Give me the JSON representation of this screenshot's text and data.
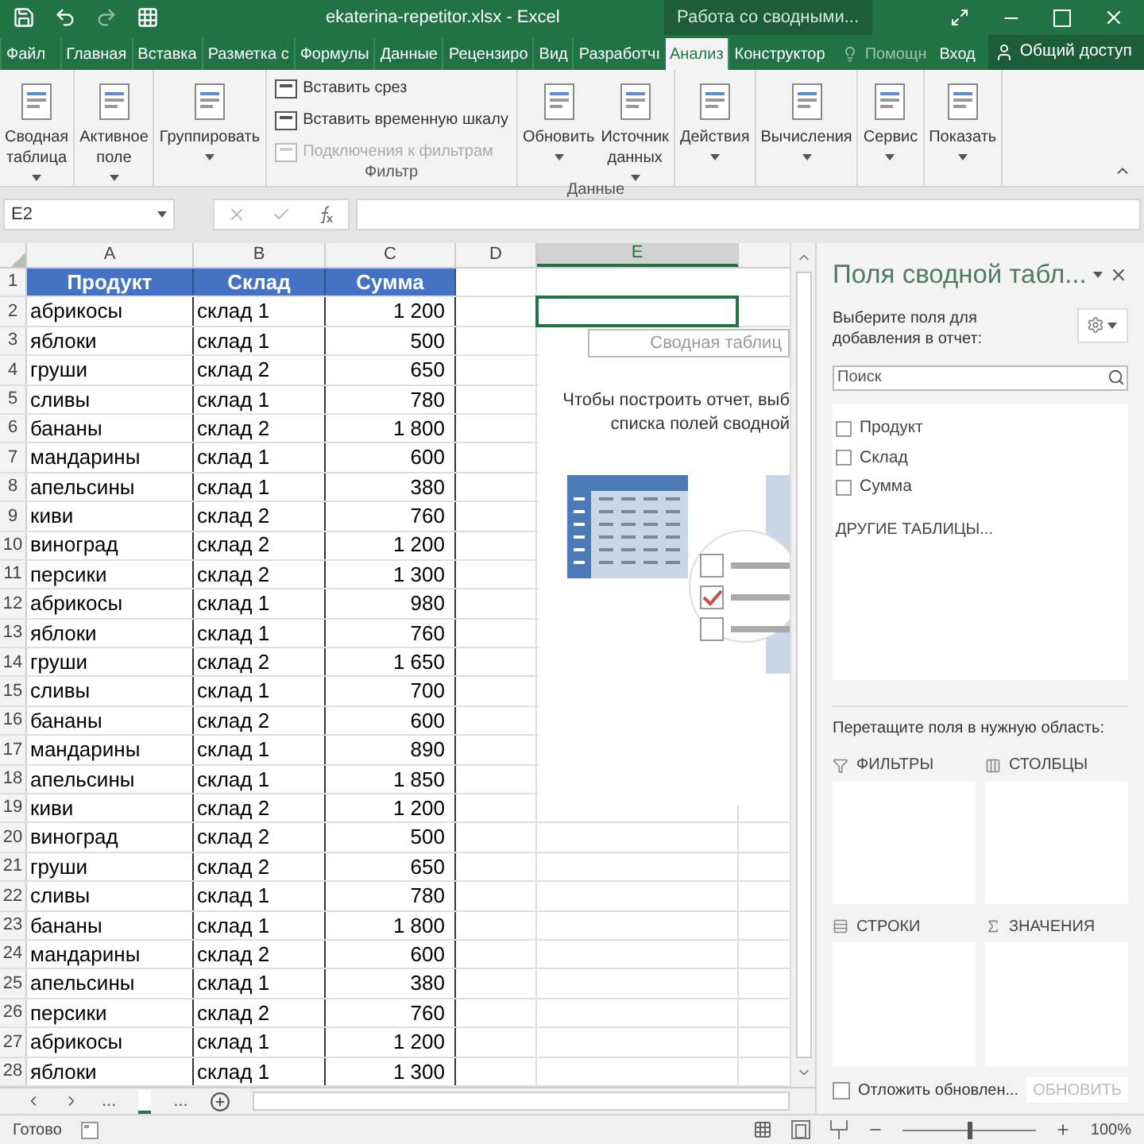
{
  "title_bar": {
    "filename": "ekaterina-repetitor.xlsx - Excel",
    "context": "Работа со сводными..."
  },
  "tabs": [
    {
      "label": "Файл",
      "selected": false
    },
    {
      "label": "Главная",
      "selected": false
    },
    {
      "label": "Вставка",
      "selected": false
    },
    {
      "label": "Разметка с",
      "selected": false
    },
    {
      "label": "Формулы",
      "selected": false
    },
    {
      "label": "Данные",
      "selected": false
    },
    {
      "label": "Рецензиро",
      "selected": false
    },
    {
      "label": "Вид",
      "selected": false
    },
    {
      "label": "Разработчı",
      "selected": false
    },
    {
      "label": "Анализ",
      "selected": true
    },
    {
      "label": "Конструктор",
      "selected": false
    }
  ],
  "tell_me": "Помощн",
  "sign_in": "Вход",
  "share": "Общий доступ",
  "ribbon": [
    {
      "buttons": [
        {
          "kind": "large",
          "lines": [
            "Сводная",
            "таблица"
          ],
          "dropdown": true
        }
      ]
    },
    {
      "buttons": [
        {
          "kind": "large",
          "lines": [
            "Активное",
            "поле"
          ],
          "dropdown": true
        }
      ]
    },
    {
      "buttons": [
        {
          "kind": "large",
          "lines": [
            "Группировать"
          ],
          "dropdown": true
        }
      ]
    },
    {
      "label": "Фильтр",
      "buttons": [
        {
          "kind": "small",
          "lines": [
            "Вставить срез"
          ],
          "disabled": false
        },
        {
          "kind": "small",
          "lines": [
            "Вставить временную шкалу"
          ],
          "disabled": false
        },
        {
          "kind": "small",
          "lines": [
            "Подключения к фильтрам"
          ],
          "disabled": true
        }
      ]
    },
    {
      "label": "Данные",
      "buttons": [
        {
          "kind": "large",
          "lines": [
            "Обновить"
          ],
          "dropdown": true
        },
        {
          "kind": "large",
          "lines": [
            "Источник",
            "данных"
          ],
          "dropdown": true
        }
      ]
    },
    {
      "buttons": [
        {
          "kind": "large",
          "lines": [
            "Действия"
          ],
          "dropdown": true
        }
      ]
    },
    {
      "buttons": [
        {
          "kind": "large",
          "lines": [
            "Вычисления"
          ],
          "dropdown": true
        }
      ]
    },
    {
      "buttons": [
        {
          "kind": "large",
          "lines": [
            "Сервис"
          ],
          "dropdown": true
        }
      ]
    },
    {
      "buttons": [
        {
          "kind": "large",
          "lines": [
            "Показать"
          ],
          "dropdown": true
        }
      ]
    }
  ],
  "name_box": "E2",
  "columns": [
    {
      "label": "A",
      "selected": false
    },
    {
      "label": "B",
      "selected": false
    },
    {
      "label": "C",
      "selected": false
    },
    {
      "label": "D",
      "selected": false
    },
    {
      "label": "E",
      "selected": true
    }
  ],
  "header_row": {
    "n": "1",
    "cells": [
      "Продукт",
      "Склад",
      "Сумма"
    ]
  },
  "rows": [
    {
      "n": "2",
      "product": "абрикосы",
      "store": "склад 1",
      "sum": "1 200"
    },
    {
      "n": "3",
      "product": "яблоки",
      "store": "склад 1",
      "sum": "500"
    },
    {
      "n": "4",
      "product": "груши",
      "store": "склад 2",
      "sum": "650"
    },
    {
      "n": "5",
      "product": "сливы",
      "store": "склад 1",
      "sum": "780"
    },
    {
      "n": "6",
      "product": "бананы",
      "store": "склад 2",
      "sum": "1 800"
    },
    {
      "n": "7",
      "product": "мандарины",
      "store": "склад 1",
      "sum": "600"
    },
    {
      "n": "8",
      "product": "апельсины",
      "store": "склад 1",
      "sum": "380"
    },
    {
      "n": "9",
      "product": "киви",
      "store": "склад 2",
      "sum": "760"
    },
    {
      "n": "10",
      "product": "виноград",
      "store": "склад 2",
      "sum": "1 200"
    },
    {
      "n": "11",
      "product": "персики",
      "store": "склад 2",
      "sum": "1 300"
    },
    {
      "n": "12",
      "product": "абрикосы",
      "store": "склад 1",
      "sum": "980"
    },
    {
      "n": "13",
      "product": "яблоки",
      "store": "склад 1",
      "sum": "760"
    },
    {
      "n": "14",
      "product": "груши",
      "store": "склад 2",
      "sum": "1 650"
    },
    {
      "n": "15",
      "product": "сливы",
      "store": "склад 1",
      "sum": "700"
    },
    {
      "n": "16",
      "product": "бананы",
      "store": "склад 2",
      "sum": "600"
    },
    {
      "n": "17",
      "product": "мандарины",
      "store": "склад 1",
      "sum": "890"
    },
    {
      "n": "18",
      "product": "апельсины",
      "store": "склад 1",
      "sum": "1 850"
    },
    {
      "n": "19",
      "product": "киви",
      "store": "склад 2",
      "sum": "1 200"
    },
    {
      "n": "20",
      "product": "виноград",
      "store": "склад 2",
      "sum": "500"
    },
    {
      "n": "21",
      "product": "груши",
      "store": "склад 2",
      "sum": "650"
    },
    {
      "n": "22",
      "product": "сливы",
      "store": "склад 1",
      "sum": "780"
    },
    {
      "n": "23",
      "product": "бананы",
      "store": "склад 1",
      "sum": "1 800"
    },
    {
      "n": "24",
      "product": "мандарины",
      "store": "склад 2",
      "sum": "600"
    },
    {
      "n": "25",
      "product": "апельсины",
      "store": "склад 1",
      "sum": "380"
    },
    {
      "n": "26",
      "product": "персики",
      "store": "склад 2",
      "sum": "760"
    },
    {
      "n": "27",
      "product": "абрикосы",
      "store": "склад 1",
      "sum": "1 200"
    },
    {
      "n": "28",
      "product": "яблоки",
      "store": "склад 1",
      "sum": "1 300"
    }
  ],
  "pivot_placeholder": {
    "title": "Сводная таблиц",
    "lines": [
      "Чтобы построить отчет, выб",
      "списка полей сводной"
    ]
  },
  "sheet_tabs": [
    "...",
    "..."
  ],
  "pane": {
    "title": "Поля сводной табл...",
    "prompt": "Выберите поля для добавления в отчет:",
    "search": {
      "placeholder": "Поиск"
    },
    "fields": [
      {
        "label": "Продукт",
        "checked": false
      },
      {
        "label": "Склад",
        "checked": false
      },
      {
        "label": "Сумма",
        "checked": false
      }
    ],
    "more_tables": "ДРУГИЕ ТАБЛИЦЫ...",
    "drag_hint": "Перетащите поля в нужную область:",
    "areas": [
      {
        "kind": "filters",
        "label": "ФИЛЬТРЫ"
      },
      {
        "kind": "columns",
        "label": "СТОЛБЦЫ"
      },
      {
        "kind": "rows",
        "label": "СТРОКИ"
      },
      {
        "kind": "values",
        "label": "ЗНАЧЕНИЯ"
      }
    ],
    "defer": {
      "label": "Отложить обновлен...",
      "checked": false
    },
    "update_button": {
      "label": "ОБНОВИТЬ",
      "disabled": true
    }
  },
  "status_bar": {
    "status": "Готово",
    "zoom": {
      "level": 0.5,
      "reading": "100%"
    }
  }
}
